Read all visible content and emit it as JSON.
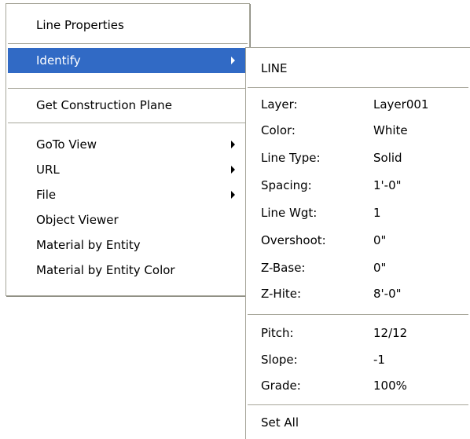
{
  "context_menu": {
    "items": {
      "line_properties": "Line Properties",
      "identify": "Identify",
      "get_construction_plane": "Get Construction Plane",
      "goto_view": "GoTo View",
      "url": "URL",
      "file": "File",
      "object_viewer": "Object Viewer",
      "material_by_entity": "Material by Entity",
      "material_by_entity_color": "Material by Entity Color"
    },
    "highlight_color": "#316ac5"
  },
  "identify_submenu": {
    "title": "LINE",
    "properties": [
      {
        "label": "Layer:",
        "value": "Layer001"
      },
      {
        "label": "Color:",
        "value": "White"
      },
      {
        "label": "Line Type:",
        "value": "Solid"
      },
      {
        "label": "Spacing:",
        "value": "1'-0\""
      },
      {
        "label": "Line Wgt:",
        "value": "1"
      },
      {
        "label": "Overshoot:",
        "value": "0\""
      },
      {
        "label": "Z-Base:",
        "value": "0\""
      },
      {
        "label": "Z-Hite:",
        "value": "8'-0\""
      }
    ],
    "slope_info": [
      {
        "label": "Pitch:",
        "value": "12/12"
      },
      {
        "label": "Slope:",
        "value": "-1"
      },
      {
        "label": "Grade:",
        "value": "100%"
      }
    ],
    "set_all": "Set All"
  }
}
